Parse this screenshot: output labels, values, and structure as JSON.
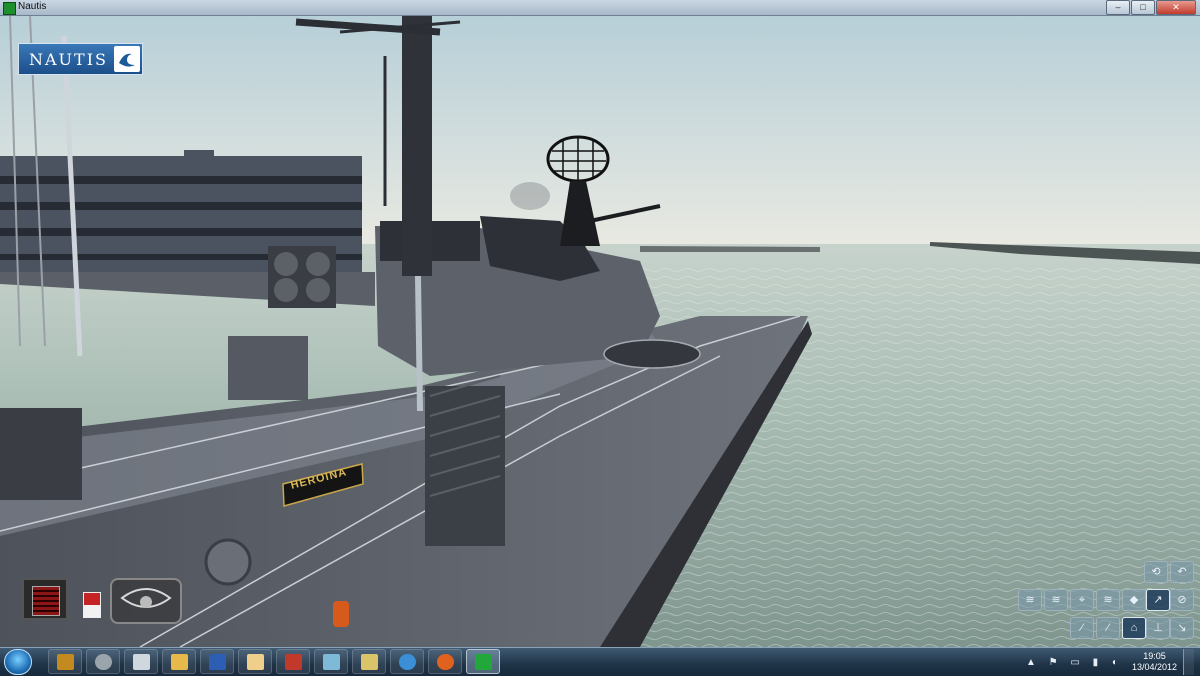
{
  "window": {
    "title": "Nautis",
    "minimize_glyph": "–",
    "maximize_glyph": "□",
    "close_glyph": "✕"
  },
  "logo": {
    "text": "NAUTIS",
    "icon": "wave-logo-icon"
  },
  "scene": {
    "ship_nameplate": "HEROINA"
  },
  "hud": {
    "throttle_icon": "engine-telegraph-icon",
    "indicator_icon": "status-flag-icon",
    "wheel_icon": "helm-wheel-icon"
  },
  "tools": [
    {
      "icon": "camera-rotate-icon",
      "glyph": "⟲"
    },
    {
      "icon": "undo-arrow-icon",
      "glyph": "↶"
    },
    {
      "icon": "view-1-icon",
      "glyph": "≋"
    },
    {
      "icon": "view-2-icon",
      "glyph": "≋"
    },
    {
      "icon": "view-3-icon",
      "glyph": "⌖"
    },
    {
      "icon": "view-4-icon",
      "glyph": "≋"
    },
    {
      "icon": "view-5-icon",
      "glyph": "◆"
    },
    {
      "icon": "view-6-icon",
      "glyph": "↗"
    },
    {
      "icon": "view-7-icon",
      "glyph": "⊘"
    },
    {
      "icon": "view-8-icon",
      "glyph": "⁄"
    },
    {
      "icon": "view-9-icon",
      "glyph": "⁄"
    },
    {
      "icon": "camera-tripod-icon",
      "glyph": "⌂"
    },
    {
      "icon": "view-10-icon",
      "glyph": "⊥"
    },
    {
      "icon": "view-11-icon",
      "glyph": "↘"
    }
  ],
  "taskbar": {
    "items": [
      {
        "icon": "shield-app-icon",
        "color": "#c58a1f"
      },
      {
        "icon": "gear-app-icon",
        "color": "#9aa4ad"
      },
      {
        "icon": "calculator-app-icon",
        "color": "#cfd8df"
      },
      {
        "icon": "folder-app-icon",
        "color": "#e6b94a"
      },
      {
        "icon": "word-app-icon",
        "color": "#2c5fb3"
      },
      {
        "icon": "hand-app-icon",
        "color": "#f0cf8a"
      },
      {
        "icon": "presentation-app-icon",
        "color": "#c0392b"
      },
      {
        "icon": "note-app-icon",
        "color": "#7fb9d8"
      },
      {
        "icon": "chat-app-icon",
        "color": "#d9c46a"
      },
      {
        "icon": "messenger-app-icon",
        "color": "#3a8fd6"
      },
      {
        "icon": "firefox-app-icon",
        "color": "#e0621d"
      },
      {
        "icon": "nautis-play-app-icon",
        "color": "#22a83a"
      }
    ],
    "tray_glyphs": "▲ ⚑ ▭ ▮ ◖",
    "time": "19:05",
    "date": "13/04/2012"
  }
}
